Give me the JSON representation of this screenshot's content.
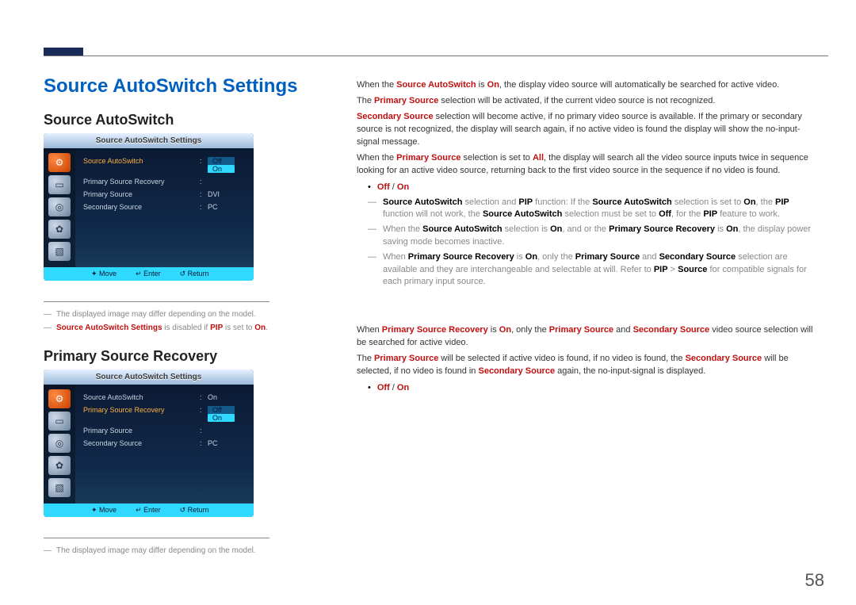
{
  "page_number": "58",
  "left": {
    "h1": "Source AutoSwitch Settings",
    "section1": {
      "h2": "Source AutoSwitch",
      "osd_title": "Source AutoSwitch Settings",
      "rows": [
        {
          "label": "Source AutoSwitch",
          "val": "Off",
          "opt_off": "Off",
          "opt_on": "On",
          "hl": true,
          "select": true
        },
        {
          "label": "Primary Source Recovery",
          "val": ""
        },
        {
          "label": "Primary Source",
          "val": "DVI"
        },
        {
          "label": "Secondary Source",
          "val": "PC"
        }
      ],
      "footer": {
        "move": "Move",
        "enter": "Enter",
        "return": "Return"
      },
      "note1": "The displayed image may differ depending on the model.",
      "note2_a": "Source AutoSwitch Settings",
      "note2_b": " is disabled if ",
      "note2_c": "PIP",
      "note2_d": " is set to ",
      "note2_e": "On",
      "note2_f": "."
    },
    "section2": {
      "h2": "Primary Source Recovery",
      "osd_title": "Source AutoSwitch Settings",
      "rows": [
        {
          "label": "Source AutoSwitch",
          "val": "On"
        },
        {
          "label": "Primary Source Recovery",
          "val": "",
          "opt_off": "Off",
          "opt_on": "On",
          "hl": true,
          "select": true
        },
        {
          "label": "Primary Source",
          "val": ""
        },
        {
          "label": "Secondary Source",
          "val": "PC"
        }
      ],
      "footer": {
        "move": "Move",
        "enter": "Enter",
        "return": "Return"
      },
      "note1": "The displayed image may differ depending on the model."
    }
  },
  "right": {
    "p1a": "When the ",
    "p1b": "Source AutoSwitch",
    "p1c": " is ",
    "p1d": "On",
    "p1e": ", the display video source will automatically be searched for active video.",
    "p2a": "The ",
    "p2b": "Primary Source",
    "p2c": " selection will be activated, if the current video source is not recognized.",
    "p3a": "Secondary Source",
    "p3b": " selection will become active, if no primary video source is available. If the primary or secondary source is not recognized, the display will search again, if no active video is found the display will show the no-input-signal message.",
    "p4a": "When the ",
    "p4b": "Primary Source",
    "p4c": " selection is set to ",
    "p4d": "All",
    "p4e": ", the display will search all the video source inputs twice in sequence looking for an active video source, returning back to the first video source in the sequence if no video is found.",
    "opts1a": "Off",
    "opts1b": " / ",
    "opts1c": "On",
    "d1a": "Source AutoSwitch",
    "d1b": " selection and ",
    "d1c": "PIP",
    "d1d": " function: If the ",
    "d1e": "Source AutoSwitch",
    "d1f": " selection is set to ",
    "d1g": "On",
    "d1h": ", the ",
    "d1i": "PIP",
    "d1j": " function will not work, the ",
    "d1k": "Source AutoSwitch",
    "d1l": " selection must be set to ",
    "d1m": "Off",
    "d1n": ", for the ",
    "d1o": "PIP",
    "d1p": " feature to work.",
    "d2a": "When the ",
    "d2b": "Source AutoSwitch",
    "d2c": " selection is ",
    "d2d": "On",
    "d2e": ", and or the ",
    "d2f": "Primary Source Recovery",
    "d2g": " is ",
    "d2h": "On",
    "d2i": ", the display power saving mode becomes inactive.",
    "d3a": "When ",
    "d3b": "Primary Source Recovery",
    "d3c": " is ",
    "d3d": "On",
    "d3e": ", only the ",
    "d3f": "Primary Source",
    "d3g": " and ",
    "d3h": "Secondary Source",
    "d3i": " selection are available and they are interchangeable and selectable at will. Refer to ",
    "d3j": "PIP",
    "d3k": " > ",
    "d3l": "Source",
    "d3m": " for compatible signals for each primary input source.",
    "p5a": "When ",
    "p5b": "Primary Source Recovery",
    "p5c": " is ",
    "p5d": "On",
    "p5e": ", only the ",
    "p5f": "Primary Source",
    "p5g": " and ",
    "p5h": "Secondary Source",
    "p5i": " video source selection will be searched for active video.",
    "p6a": "The ",
    "p6b": "Primary Source",
    "p6c": " will be selected if active video is found, if no video is found, the ",
    "p6d": "Secondary Source",
    "p6e": " will be selected, if no video is found in ",
    "p6f": "Secondary Source",
    "p6g": " again, the no-input-signal is displayed.",
    "opts2a": "Off",
    "opts2b": " / ",
    "opts2c": "On"
  }
}
